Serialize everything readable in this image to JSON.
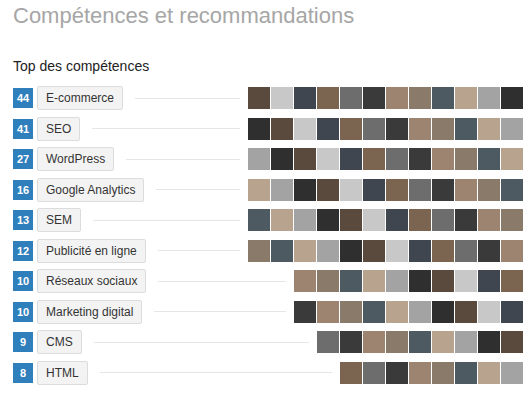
{
  "section": {
    "title": "Compétences et recommandations",
    "subtitle": "Top des compétences"
  },
  "skills": [
    {
      "count": "44",
      "name": "E-commerce"
    },
    {
      "count": "41",
      "name": "SEO"
    },
    {
      "count": "27",
      "name": "WordPress"
    },
    {
      "count": "16",
      "name": "Google Analytics"
    },
    {
      "count": "13",
      "name": "SEM"
    },
    {
      "count": "12",
      "name": "Publicité en ligne"
    },
    {
      "count": "10",
      "name": "Réseaux sociaux"
    },
    {
      "count": "10",
      "name": "Marketing digital"
    },
    {
      "count": "9",
      "name": "CMS"
    },
    {
      "count": "8",
      "name": "HTML"
    }
  ]
}
